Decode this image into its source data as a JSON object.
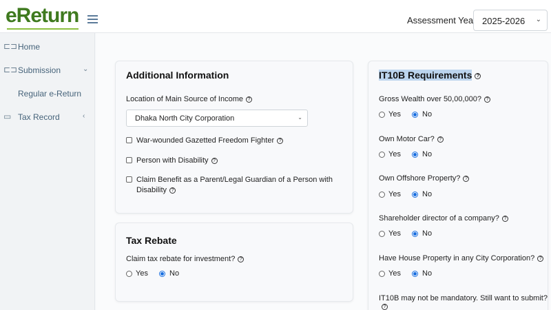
{
  "app": {
    "logo": "eReturn"
  },
  "header": {
    "assessment_year_label": "Assessment Year",
    "assessment_year_value": "2025-2026"
  },
  "sidebar": {
    "items": [
      {
        "label": "Home",
        "icon": "car-icon"
      },
      {
        "label": "Submission",
        "icon": "vehicle-icon",
        "chevron": "⌄"
      },
      {
        "label": "Regular e-Return"
      },
      {
        "label": "Tax Record",
        "icon": "tax-record-icon",
        "chevron": "‹"
      }
    ]
  },
  "additional_info": {
    "title": "Additional Information",
    "location_label": "Location of Main Source of Income",
    "location_value": "Dhaka North City Corporation",
    "checkboxes": [
      {
        "label": "War-wounded Gazetted Freedom Fighter",
        "checked": false
      },
      {
        "label": "Person with Disability",
        "checked": false
      },
      {
        "label": "Claim Benefit as a Parent/Legal Guardian of a Person with",
        "label2": "Disability",
        "checked": false
      }
    ]
  },
  "tax_rebate": {
    "title": "Tax Rebate",
    "question": "Claim tax rebate for investment?",
    "yes": "Yes",
    "no": "No",
    "selected": "No"
  },
  "it10b": {
    "title": "IT10B Requirements",
    "questions": [
      {
        "label": "Gross Wealth over 50,00,000?",
        "yes": "Yes",
        "no": "No",
        "selected": "No"
      },
      {
        "label": "Own Motor Car?",
        "yes": "Yes",
        "no": "No",
        "selected": "No"
      },
      {
        "label": "Own Offshore Property?",
        "yes": "Yes",
        "no": "No",
        "selected": "No"
      },
      {
        "label": "Shareholder director of a company?",
        "yes": "Yes",
        "no": "No",
        "selected": "No"
      },
      {
        "label": "Have House Property in any City Corporation?",
        "yes": "Yes",
        "no": "No",
        "selected": "No"
      },
      {
        "label": "IT10B may not be mandatory. Still want to submit?"
      }
    ]
  },
  "colors": {
    "brand_green": "#3f7a1f",
    "radio_blue": "#1a6fe0",
    "highlight": "#bcd5ee"
  }
}
